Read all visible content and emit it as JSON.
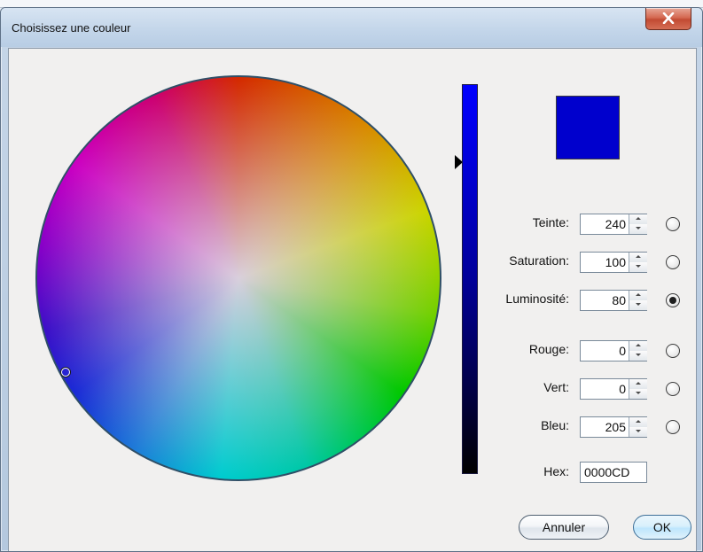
{
  "window": {
    "title": "Choisissez une couleur",
    "close_icon": "close-icon"
  },
  "color": {
    "preview_hex": "#0000CD"
  },
  "fields": {
    "teinte": {
      "label": "Teinte:",
      "value": "240",
      "selected": false
    },
    "saturation": {
      "label": "Saturation:",
      "value": "100",
      "selected": false
    },
    "luminosite": {
      "label": "Luminosité:",
      "value": "80",
      "selected": true
    },
    "rouge": {
      "label": "Rouge:",
      "value": "0",
      "selected": false
    },
    "vert": {
      "label": "Vert:",
      "value": "0",
      "selected": false
    },
    "bleu": {
      "label": "Bleu:",
      "value": "205",
      "selected": false
    }
  },
  "hex": {
    "label": "Hex:",
    "value": "0000CD"
  },
  "buttons": {
    "cancel": "Annuler",
    "ok": "OK"
  }
}
